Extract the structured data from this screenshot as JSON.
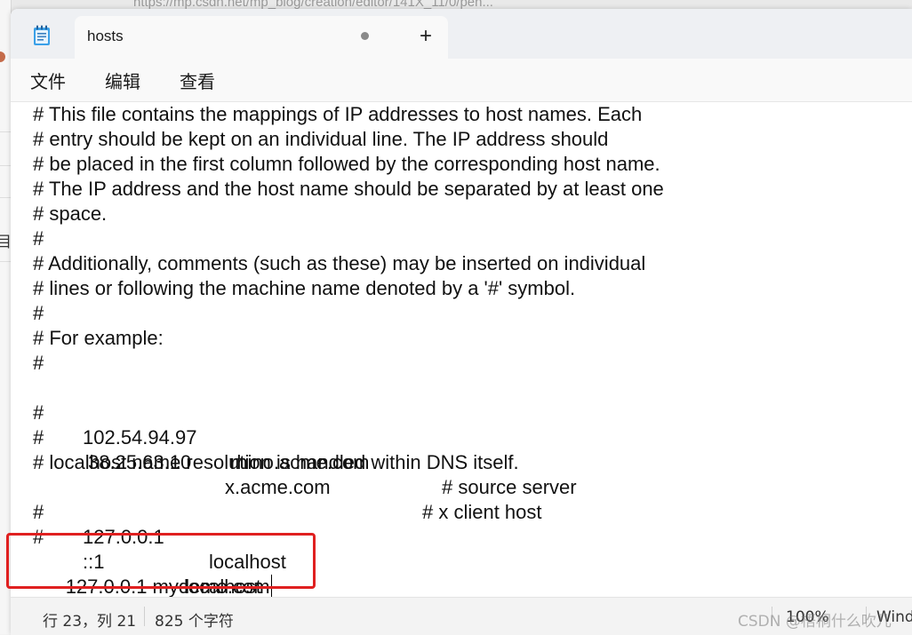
{
  "background": {
    "url_fragment": "https://mp.csdn.net/mp_blog/creation/editor/141X_11/0/pen..."
  },
  "window": {
    "tab": {
      "title": "hosts"
    },
    "new_tab_label": "+",
    "menu": {
      "file": "文件",
      "edit": "编辑",
      "view": "查看"
    }
  },
  "editor": {
    "lines": [
      "# This file contains the mappings of IP addresses to host names. Each",
      "# entry should be kept on an individual line. The IP address should",
      "# be placed in the first column followed by the corresponding host name.",
      "# The IP address and the host name should be separated by at least one",
      "# space.",
      "#",
      "# Additionally, comments (such as these) may be inserted on individual",
      "# lines or following the machine name denoted by a '#' symbol.",
      "#",
      "# For example:",
      "#"
    ],
    "example1": {
      "hash": "#",
      "ip": "102.54.94.97",
      "host": "rhino.acme.com",
      "comment": "# source server"
    },
    "example2": {
      "hash": "#",
      "ip": "38.25.63.10",
      "host": "x.acme.com",
      "comment": "# x client host"
    },
    "localhost_comment": "# localhost name resolution is handled within DNS itself.",
    "local1": {
      "hash": "#",
      "ip": "127.0.0.1",
      "host": "localhost"
    },
    "local2": {
      "hash": "#",
      "ip": "::1",
      "host": "localhost"
    },
    "new_entry": "127.0.0.1 mydemo.com"
  },
  "status": {
    "position": "行 23，列 21",
    "chars": "825 个字符",
    "zoom": "100%",
    "encoding": "Wind"
  },
  "watermark": "CSDN @梧桐什么吹儿"
}
